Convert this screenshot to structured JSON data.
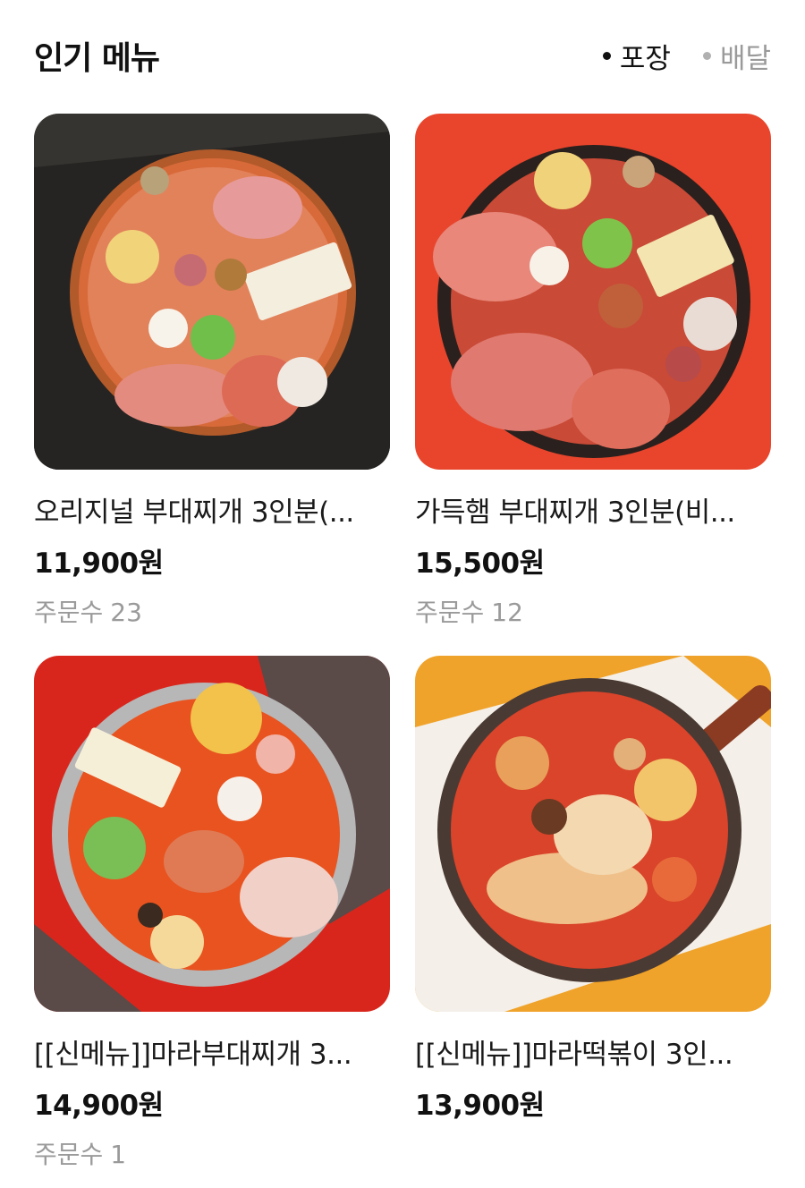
{
  "header": {
    "title": "인기 메뉴",
    "filters": [
      {
        "label": "포장",
        "active": true
      },
      {
        "label": "배달",
        "active": false
      }
    ]
  },
  "menu_items": [
    {
      "name": "오리지널 부대찌개 3인분(...",
      "price": "11,900원",
      "orders_label": "주문수",
      "orders_count": "23"
    },
    {
      "name": "가득햄 부대찌개 3인분(비...",
      "price": "15,500원",
      "orders_label": "주문수",
      "orders_count": "12"
    },
    {
      "name": "[[신메뉴]]마라부대찌개 3...",
      "price": "14,900원",
      "orders_label": "주문수",
      "orders_count": "1"
    },
    {
      "name": "[[신메뉴]]마라떡볶이 3인...",
      "price": "13,900원",
      "orders_label": "",
      "orders_count": ""
    }
  ],
  "colors": {
    "title": "#111111",
    "inactive": "#9a9a9a",
    "bg_card1": "#2b2b2b",
    "bg_card2": "#e8452c",
    "bg_card3": "#d9261c",
    "bg_card4": "#f0a32a"
  }
}
